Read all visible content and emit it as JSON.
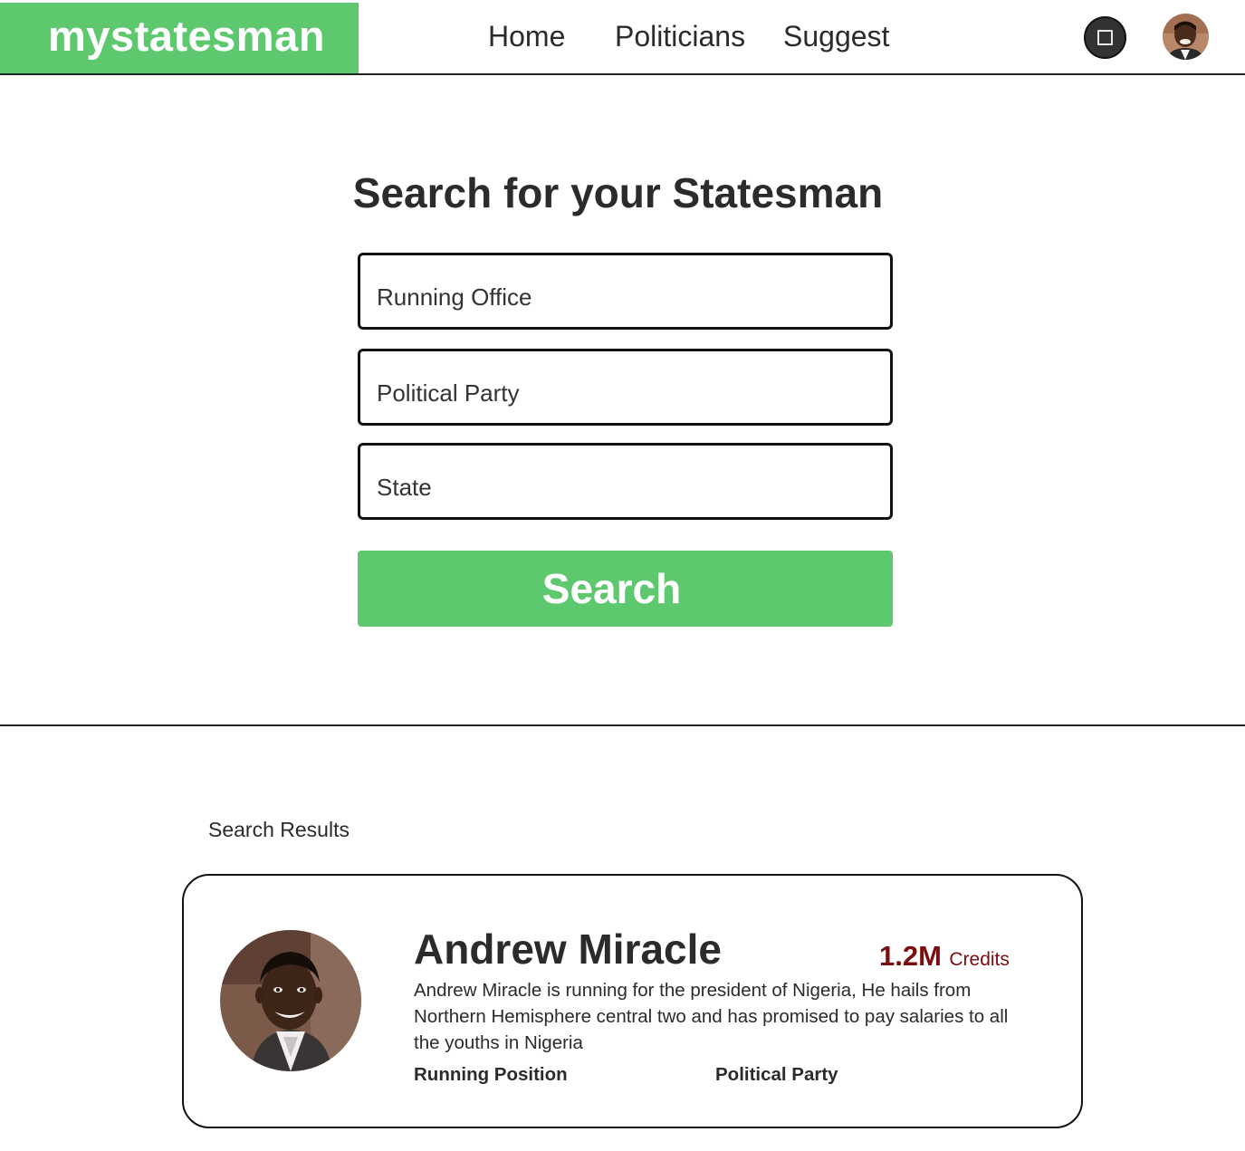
{
  "brand": {
    "logo_text": "mystatesman",
    "accent_color": "#5ec86f"
  },
  "nav": {
    "items": [
      {
        "label": "Home"
      },
      {
        "label": "Politicians"
      },
      {
        "label": "Suggest"
      }
    ],
    "square_button_icon": "square-icon",
    "avatar_icon": "user-avatar"
  },
  "search": {
    "title": "Search for your Statesman",
    "fields": {
      "running_office": {
        "placeholder": "Running Office",
        "value": ""
      },
      "political_party": {
        "placeholder": "Political Party",
        "value": ""
      },
      "state": {
        "placeholder": "State",
        "value": ""
      }
    },
    "button_label": "Search"
  },
  "results": {
    "label": "Search Results",
    "items": [
      {
        "name": "Andrew Miracle",
        "credits_value": "1.2M",
        "credits_label": "Credits",
        "credits_color": "#7a0d0d",
        "description": "Andrew Miracle is running for the president of Nigeria, He hails from Northern Hemisphere central two and has promised to pay salaries to all the youths in Nigeria",
        "running_position_label": "Running Position",
        "political_party_label": "Political Party"
      }
    ]
  }
}
